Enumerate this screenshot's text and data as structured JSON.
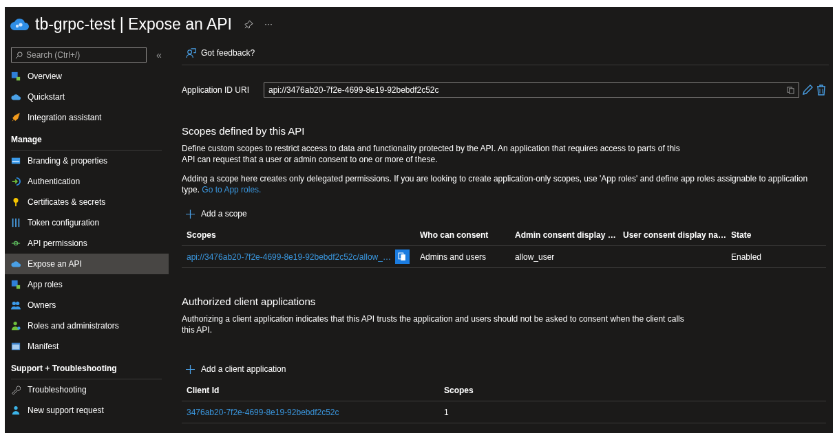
{
  "header": {
    "title": "tb-grpc-test | Expose an API",
    "more": "···"
  },
  "sidebar": {
    "search": {
      "placeholder": "Search (Ctrl+/)"
    },
    "collapse": "«",
    "groups": [
      {
        "items": [
          {
            "label": "Overview",
            "selected": false
          },
          {
            "label": "Quickstart",
            "selected": false
          },
          {
            "label": "Integration assistant",
            "selected": false
          }
        ]
      },
      {
        "heading": "Manage",
        "items": [
          {
            "label": "Branding & properties",
            "selected": false
          },
          {
            "label": "Authentication",
            "selected": false
          },
          {
            "label": "Certificates & secrets",
            "selected": false
          },
          {
            "label": "Token configuration",
            "selected": false
          },
          {
            "label": "API permissions",
            "selected": false
          },
          {
            "label": "Expose an API",
            "selected": true
          },
          {
            "label": "App roles",
            "selected": false
          },
          {
            "label": "Owners",
            "selected": false
          },
          {
            "label": "Roles and administrators",
            "selected": false
          },
          {
            "label": "Manifest",
            "selected": false
          }
        ]
      },
      {
        "heading": "Support + Troubleshooting",
        "items": [
          {
            "label": "Troubleshooting",
            "selected": false
          },
          {
            "label": "New support request",
            "selected": false
          }
        ]
      }
    ]
  },
  "toolbar": {
    "feedback": "Got feedback?"
  },
  "app_id_uri": {
    "label": "Application ID URI",
    "value": "api://3476ab20-7f2e-4699-8e19-92bebdf2c52c"
  },
  "scopes_section": {
    "title": "Scopes defined by this API",
    "paragraph_1": "Define custom scopes to restrict access to data and functionality protected by the API. An application that requires access to parts of this API can request that a user or admin consent to one or more of these.",
    "paragraph_2": "Adding a scope here creates only delegated permissions. If you are looking to create application-only scopes, use 'App roles' and define app roles assignable to application type.",
    "link": "Go to App roles.",
    "add": "Add a scope",
    "table": {
      "columns": [
        "Scopes",
        "Who can consent",
        "Admin consent display …",
        "User consent display na…",
        "State"
      ],
      "rows": [
        [
          "api://3476ab20-7f2e-4699-8e19-92bebdf2c52c/allow_…",
          "Admins and users",
          "allow_user",
          "",
          "Enabled"
        ]
      ]
    }
  },
  "clients_section": {
    "title": "Authorized client applications",
    "paragraph": "Authorizing a client application indicates that this API trusts the application and users should not be asked to consent when the client calls this API.",
    "add": "Add a client application",
    "table": {
      "columns": [
        "Client Id",
        "Scopes"
      ],
      "rows": [
        [
          "3476ab20-7f2e-4699-8e19-92bebdf2c52c",
          "1"
        ]
      ]
    }
  }
}
